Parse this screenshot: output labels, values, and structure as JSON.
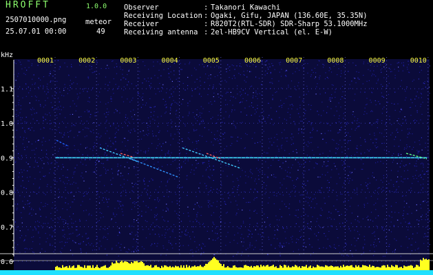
{
  "header": {
    "app_title": "HROFFT",
    "version": "1.0.0",
    "file_name": "2507010000.png",
    "date_time": "25.07.01 00:00",
    "meteor_label": "meteor",
    "meteor_count": "49"
  },
  "info": [
    {
      "label": "Observer",
      "value": "Takanori Kawachi"
    },
    {
      "label": "Receiving Location",
      "value": "Ogaki, Gifu, JAPAN (136.60E, 35.35N)"
    },
    {
      "label": "Receiver",
      "value": "R820T2(RTL-SDR) SDR-Sharp 53.1000MHz"
    },
    {
      "label": "Receiving antenna",
      "value": "2el-HB9CV Vertical (el. E-W)"
    }
  ],
  "chart_data": {
    "type": "heatmap",
    "ylabel": "kHz",
    "y_ticks": [
      "1.1",
      "1.0",
      "0.9",
      "0.8",
      "0.7",
      "0.6"
    ],
    "x_ticks": [
      "0001",
      "0002",
      "0003",
      "0004",
      "0005",
      "0006",
      "0007",
      "0008",
      "0009",
      "0010"
    ],
    "carrier_khz": 0.9,
    "colors": {
      "background": "#000000",
      "noise": "#1a1a8a",
      "carrier": "#40e0ff",
      "activity_fill": "#ffff20",
      "baseline": "#20e0ff",
      "axis": "#ffffff"
    }
  }
}
